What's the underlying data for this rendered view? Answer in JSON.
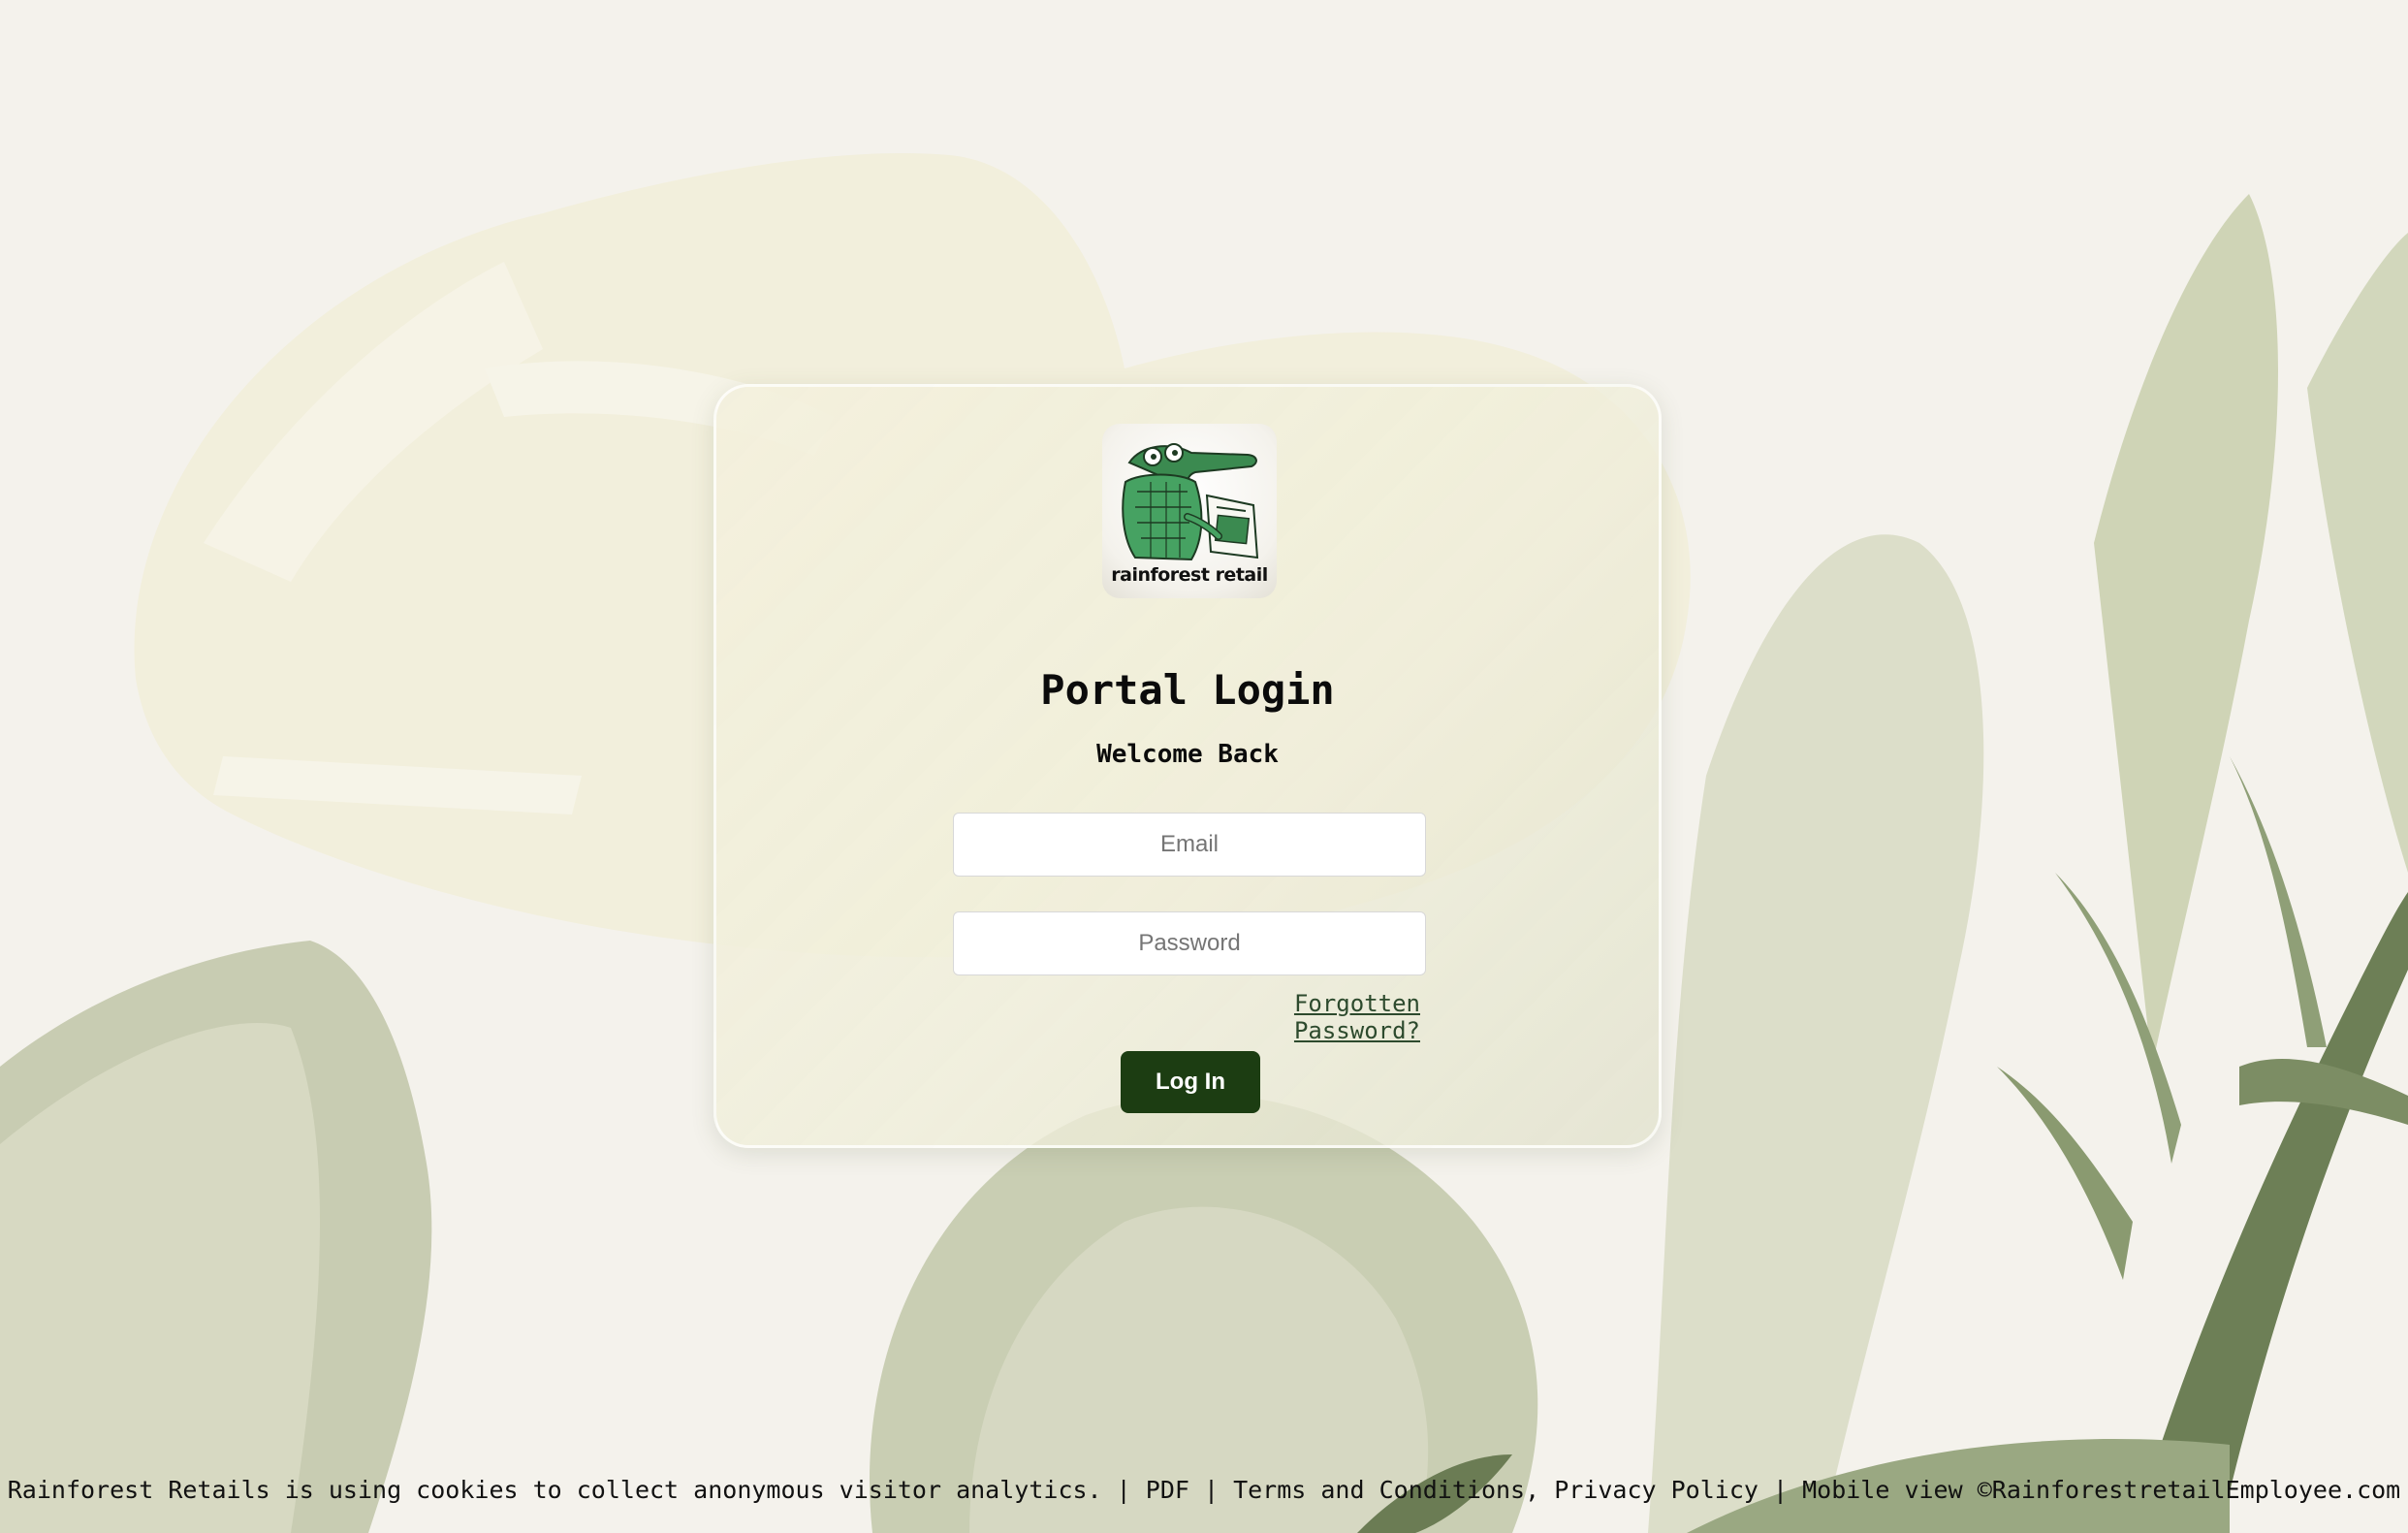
{
  "login_card": {
    "title": "Portal Login",
    "subtitle": "Welcome Back",
    "email_placeholder": "Email",
    "password_placeholder": "Password",
    "forgot_password_label": "Forgotten Password?",
    "login_button_label": "Log In"
  },
  "logo": {
    "text": "rainforest retail",
    "icon": "crocodile-reading-icon"
  },
  "footer": {
    "cookie_notice": "Rainforest Retails is using cookies to collect anonymous visitor analytics.",
    "sep1": " | ",
    "pdf_label": "PDF",
    "sep2": " | ",
    "terms_label": "Terms and Conditions",
    "sep3": ", ",
    "privacy_label": "Privacy Policy",
    "sep4": " | ",
    "mobile_label": "Mobile view",
    "sep5": " ",
    "copyright": "©RainforestretailEmployee.com"
  },
  "colors": {
    "background": "#f3f1ea",
    "button": "#1c3d12",
    "link": "#2d4a2d"
  }
}
